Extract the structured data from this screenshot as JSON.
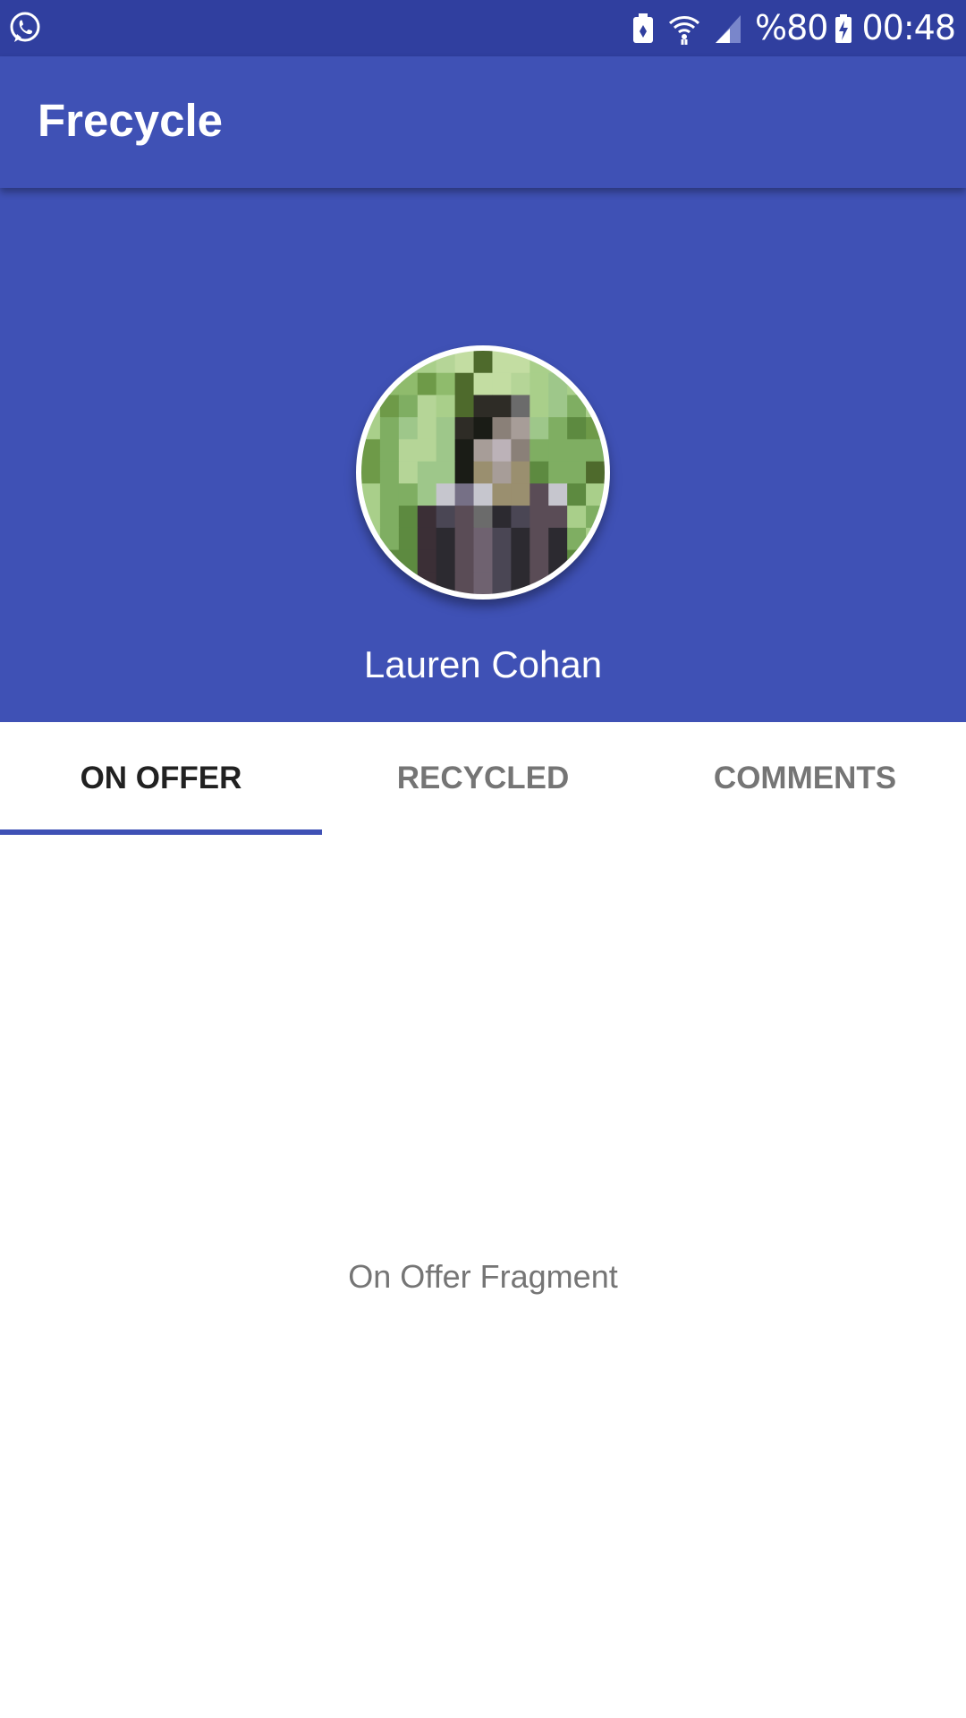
{
  "status_bar": {
    "left_icon": "whatsapp-icon",
    "battery_percent": "%80",
    "time": "00:48",
    "icons": [
      "battery-saver-icon",
      "wifi-icon",
      "cell-signal-icon",
      "battery-charging-icon"
    ]
  },
  "app_bar": {
    "title": "Frecycle"
  },
  "profile": {
    "avatar": "profile-avatar",
    "name": "Lauren Cohan"
  },
  "tabs": [
    {
      "label": "ON OFFER",
      "selected": true
    },
    {
      "label": "RECYCLED",
      "selected": false
    },
    {
      "label": "COMMENTS",
      "selected": false
    }
  ],
  "content": {
    "text": "On Offer Fragment"
  },
  "colors": {
    "status_bar": "#303f9f",
    "primary": "#3f51b5",
    "tab_active_text": "#212121",
    "tab_inactive_text": "#757575",
    "indicator": "#3f51b5",
    "background": "#ffffff"
  }
}
